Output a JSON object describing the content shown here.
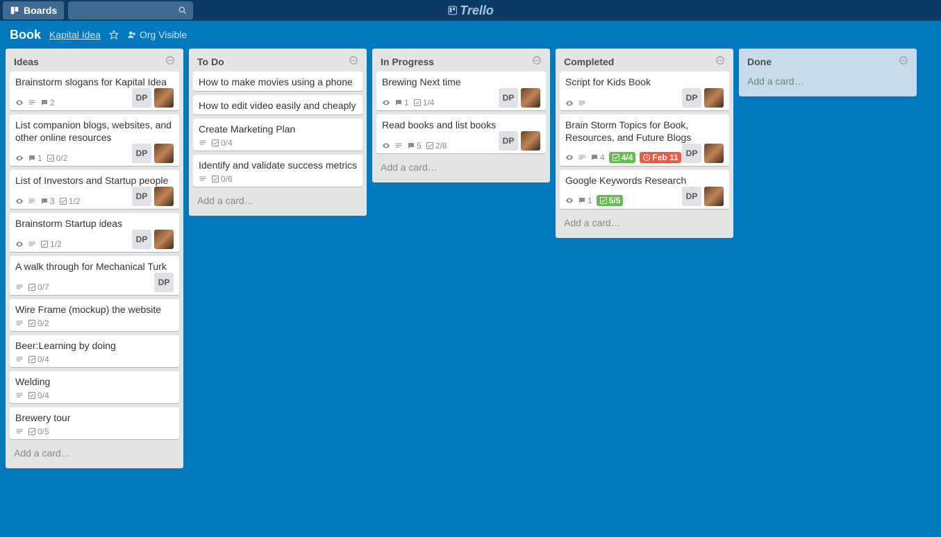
{
  "topbar": {
    "boards_label": "Boards",
    "logo_text": "Trello"
  },
  "boardbar": {
    "title": "Book",
    "team": "Kapital Idea",
    "visibility": "Org Visible"
  },
  "add_card_label": "Add a card…",
  "member_initials": "DP",
  "lists": [
    {
      "title": "Ideas",
      "cards": [
        {
          "title": "Brainstorm slogans for Kapital Idea",
          "watch": true,
          "desc": true,
          "comments": "2",
          "checklist": null,
          "members": [
            "DP",
            "avatar"
          ]
        },
        {
          "title": "List companion blogs, websites, and other online resources",
          "watch": true,
          "desc": false,
          "comments": "1",
          "checklist": "0/2",
          "members": [
            "DP",
            "avatar"
          ]
        },
        {
          "title": "List of Investors and Startup people",
          "watch": true,
          "desc": true,
          "comments": "3",
          "checklist": "1/2",
          "members": [
            "DP",
            "avatar"
          ]
        },
        {
          "title": "Brainstorm Startup ideas",
          "watch": true,
          "desc": true,
          "comments": null,
          "checklist": "1/2",
          "members": [
            "DP",
            "avatar"
          ]
        },
        {
          "title": "A walk through for Mechanical Turk",
          "watch": false,
          "desc": true,
          "comments": null,
          "checklist": "0/7",
          "members": [
            "DP"
          ]
        },
        {
          "title": "Wire Frame (mockup) the website",
          "watch": false,
          "desc": true,
          "comments": null,
          "checklist": "0/2",
          "members": []
        },
        {
          "title": "Beer:Learning by doing",
          "watch": false,
          "desc": true,
          "comments": null,
          "checklist": "0/4",
          "members": []
        },
        {
          "title": "Welding",
          "watch": false,
          "desc": true,
          "comments": null,
          "checklist": "0/4",
          "members": []
        },
        {
          "title": "Brewery tour",
          "watch": false,
          "desc": true,
          "comments": null,
          "checklist": "0/5",
          "members": []
        }
      ]
    },
    {
      "title": "To Do",
      "cards": [
        {
          "title": "How to make movies using a phone",
          "watch": false,
          "desc": false,
          "comments": null,
          "checklist": null,
          "members": []
        },
        {
          "title": "How to edit video easily and cheaply",
          "watch": false,
          "desc": false,
          "comments": null,
          "checklist": null,
          "members": []
        },
        {
          "title": "Create Marketing Plan",
          "watch": false,
          "desc": true,
          "comments": null,
          "checklist": "0/4",
          "members": []
        },
        {
          "title": "Identify and validate success metrics",
          "watch": false,
          "desc": true,
          "comments": null,
          "checklist": "0/6",
          "members": []
        }
      ]
    },
    {
      "title": "In Progress",
      "cards": [
        {
          "title": "Brewing Next time",
          "watch": true,
          "desc": false,
          "comments": "1",
          "checklist": "1/4",
          "members": [
            "DP",
            "avatar"
          ]
        },
        {
          "title": "Read books and list books",
          "watch": true,
          "desc": true,
          "comments": "5",
          "checklist": "2/8",
          "members": [
            "DP",
            "avatar"
          ]
        }
      ]
    },
    {
      "title": "Completed",
      "cards": [
        {
          "title": "Script for Kids Book",
          "watch": true,
          "desc": true,
          "comments": null,
          "checklist": null,
          "members": [
            "DP",
            "avatar"
          ]
        },
        {
          "title": "Brain Storm Topics for Book, Resources, and Future Blogs",
          "watch": true,
          "desc": true,
          "comments": "4",
          "checklist": "4/4",
          "checklist_done": true,
          "due": "Feb 11",
          "members": [
            "DP",
            "avatar"
          ]
        },
        {
          "title": "Google Keywords Research",
          "watch": true,
          "desc": false,
          "comments": "1",
          "checklist": "5/5",
          "checklist_done": true,
          "members": [
            "DP",
            "avatar"
          ]
        }
      ]
    },
    {
      "title": "Done",
      "empty": true,
      "cards": []
    }
  ]
}
